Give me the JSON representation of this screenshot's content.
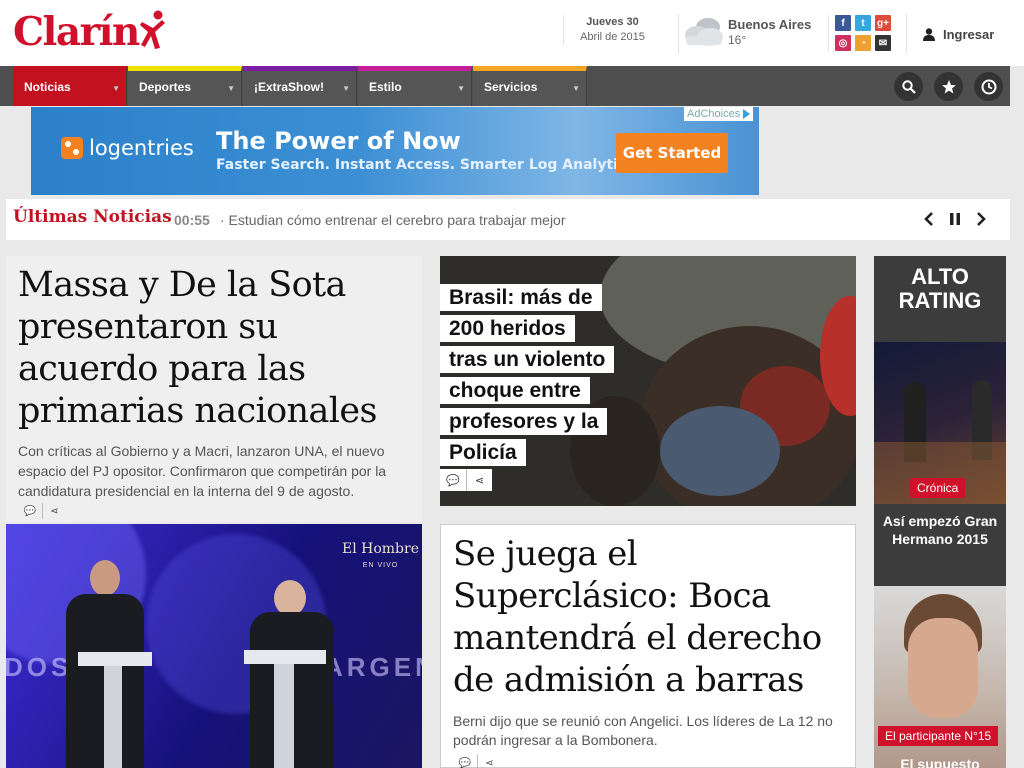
{
  "header": {
    "logo": "Clarín",
    "date_day": "Jueves 30",
    "date_month": "Abril de 2015",
    "weather_city": "Buenos Aires",
    "weather_temp": "16°",
    "login_label": "Ingresar",
    "social_icons": [
      "facebook-icon",
      "twitter-icon",
      "google-plus-icon",
      "instagram-icon",
      "rss-icon",
      "mail-icon"
    ]
  },
  "nav": {
    "items": [
      {
        "label": "Noticias",
        "color": "#c2111f"
      },
      {
        "label": "Deportes",
        "color": "#f0e100"
      },
      {
        "label": "¡ExtraShow!",
        "color": "#7a1fa2"
      },
      {
        "label": "Estilo",
        "color": "#c41e9b"
      },
      {
        "label": "Servicios",
        "color": "#f5a623"
      }
    ],
    "tools": [
      "search-icon",
      "star-icon",
      "clock-icon"
    ]
  },
  "ad": {
    "adchoices": "AdChoices",
    "brand": "logentries",
    "headline": "The Power of Now",
    "sub": "Faster Search. Instant Access. Smarter Log Analytics.",
    "cta": "Get Started"
  },
  "ticker": {
    "label": "Últimas Noticias",
    "time": "00:55",
    "text": "· Estudian cómo entrenar el cerebro para trabajar mejor"
  },
  "lead": {
    "title": "Massa y De la Sota presentaron su acuerdo para las primarias nacionales",
    "summary": "Con críticas al Gobierno y a Macri, lanzaron UNA, el nuevo espacio del PJ opositor. Confirmaron que competirán por la candidatura presidencial en la interna del 9 de agosto.",
    "photo_brand": "El Hombre",
    "photo_brand_sub": "EN VIVO",
    "photo_words": [
      "DOS",
      "ARGENT"
    ]
  },
  "middle": {
    "photo_lines": [
      "Brasil: más de",
      "200 heridos",
      "tras un violento",
      "choque entre",
      "profesores y la",
      "Policía"
    ],
    "story2_title": "Se juega el Superclásico: Boca mantendrá el derecho de admisión a barras",
    "story2_summary": "Berni dijo que se reunió con Angelici. Los líderes de La 12 no podrán ingresar a la Bombonera."
  },
  "right": {
    "title_line1": "ALTO",
    "title_line2": "RATING",
    "tag1": "Crónica",
    "caption1": "Así empezó Gran Hermano 2015",
    "tag2": "El participante N°15",
    "caption2": "El supuesto"
  }
}
